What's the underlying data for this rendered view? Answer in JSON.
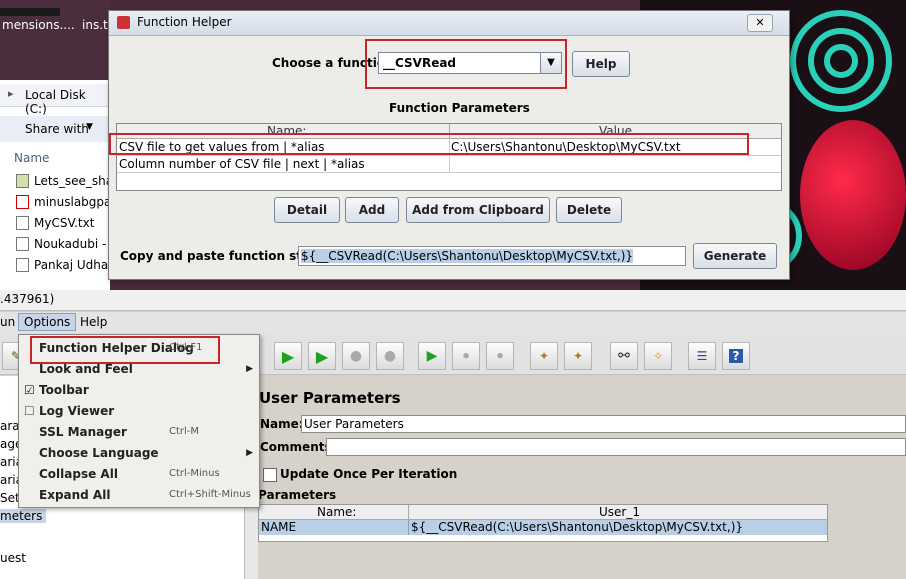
{
  "desktop": {
    "top_items": [
      "mensions....",
      "ins.t"
    ]
  },
  "explorer": {
    "address": "Local Disk (C:)",
    "share_label": "Share with",
    "column_name": "Name",
    "files": [
      "Lets_see_sharp",
      "minuslabgpad",
      "MyCSV.txt",
      "Noukadubi -",
      "Pankaj Udhas"
    ]
  },
  "function_helper": {
    "title": "Function Helper",
    "choose_label": "Choose a function",
    "selected_function": "__CSVRead",
    "help_label": "Help",
    "params_title": "Function Parameters",
    "table": {
      "headers": [
        "Name:",
        "Value"
      ],
      "rows": [
        {
          "name": "CSV file to get values from | *alias",
          "value": "C:\\Users\\Shantonu\\Desktop\\MyCSV.txt"
        },
        {
          "name": "Column number of CSV file | next | *alias",
          "value": ""
        }
      ]
    },
    "buttons": {
      "detail": "Detail",
      "add": "Add",
      "add_clipboard": "Add from Clipboard",
      "delete": "Delete",
      "generate": "Generate"
    },
    "copy_label": "Copy and paste function string",
    "function_string": "${__CSVRead(C:\\Users\\Shantonu\\Desktop\\MyCSV.txt,)}"
  },
  "jmeter": {
    "title_fragment": ".437961)",
    "menu": {
      "run_fragment": "un",
      "options": "Options",
      "help": "Help"
    },
    "options_menu": [
      {
        "label": "Function Helper Dialog",
        "accel": "Ctrl-F1",
        "checked": false,
        "submenu": false
      },
      {
        "label": "Look and Feel",
        "accel": "",
        "checked": false,
        "submenu": true
      },
      {
        "label": "Toolbar",
        "accel": "",
        "checked": true,
        "submenu": false
      },
      {
        "label": "Log Viewer",
        "accel": "",
        "checked": false,
        "submenu": false
      },
      {
        "label": "SSL Manager",
        "accel": "Ctrl-M",
        "checked": false,
        "submenu": false
      },
      {
        "label": "Choose Language",
        "accel": "",
        "checked": false,
        "submenu": true
      },
      {
        "label": "Collapse All",
        "accel": "Ctrl-Minus",
        "checked": false,
        "submenu": false
      },
      {
        "label": "Expand All",
        "accel": "Ctrl+Shift-Minus",
        "checked": false,
        "submenu": false
      }
    ],
    "tree_items": [
      "aran",
      "age",
      "aria",
      "aria",
      "Set",
      "meters",
      "uest"
    ],
    "panel": {
      "title": "User Parameters",
      "name_label": "Name:",
      "name_value": "User Parameters",
      "comments_label": "Comments:",
      "update_once_label": "Update Once Per Iteration",
      "parameters_label": "Parameters",
      "table_headers": [
        "Name:",
        "User_1"
      ],
      "table_rows": [
        {
          "name": "NAME",
          "value": "${__CSVRead(C:\\Users\\Shantonu\\Desktop\\MyCSV.txt,)}"
        }
      ]
    }
  },
  "colors": {
    "highlight": "#c8242c",
    "row_select": "#b8cfe5",
    "accent": "#2ad0b8"
  }
}
